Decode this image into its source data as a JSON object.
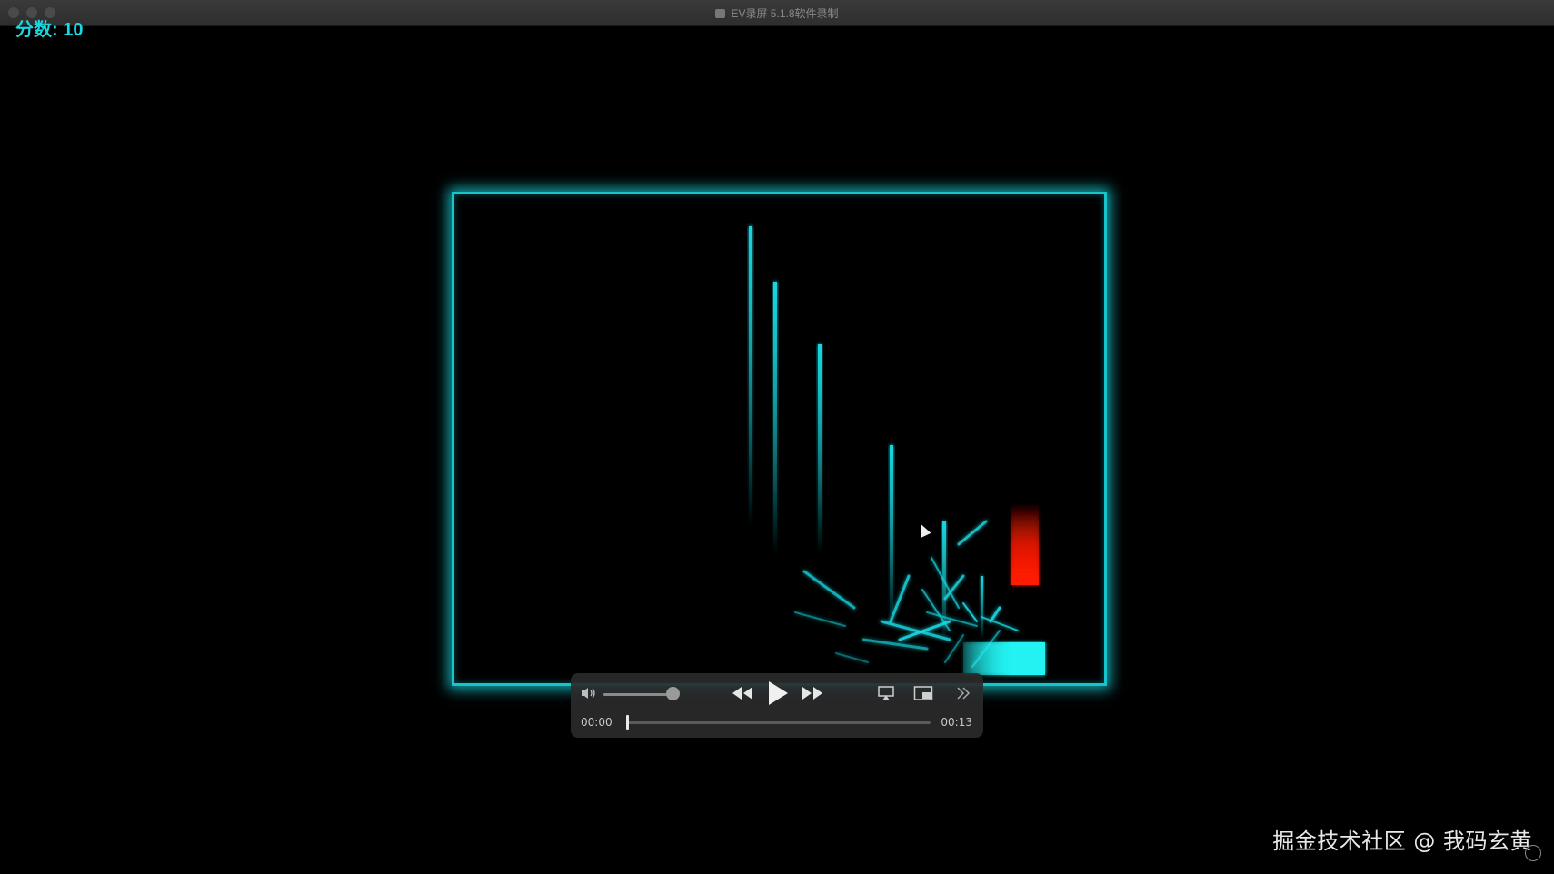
{
  "window": {
    "title": "EV录屏 5.1.8软件录制"
  },
  "game": {
    "score_text": "分数: 10",
    "colors": {
      "border": "#16c4cc",
      "particle": "#19d6e0",
      "player": "#22f2f2",
      "enemy": "#ff1a00"
    }
  },
  "player_controls": {
    "current_time": "00:00",
    "total_time": "00:13",
    "volume_level": 0.92,
    "progress_fraction": 0.0
  },
  "watermark": {
    "text": "掘金技术社区 @ 我码玄黄"
  },
  "icons": {
    "volume": "volume-icon",
    "rewind": "rewind-icon",
    "play": "play-icon",
    "fast_forward": "fast-forward-icon",
    "airplay": "airplay-icon",
    "picture_in_picture": "pip-icon",
    "more": "more-icon"
  }
}
